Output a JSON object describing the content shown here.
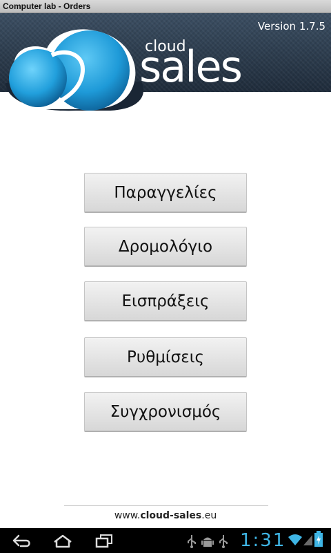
{
  "window": {
    "title": "Computer lab - Orders"
  },
  "header": {
    "version": "Version 1.7.5",
    "logo_cloud": "cloud",
    "logo_sales": "sales",
    "colors": {
      "logo_blue": "#29a6e3",
      "logo_dark": "#0a5f96"
    }
  },
  "menu": {
    "items": [
      {
        "label": "Παραγγελίες"
      },
      {
        "label": "Δρομολόγιο"
      },
      {
        "label": "Εισπράξεις"
      },
      {
        "label": "Ρυθμίσεις"
      },
      {
        "label": "Συγχρονισμός"
      }
    ]
  },
  "footer": {
    "url_prefix": "www.",
    "url_brand": "cloud-sales",
    "url_suffix": ".eu"
  },
  "system_bar": {
    "time": "1:31",
    "icons": [
      "back-icon",
      "home-icon",
      "recent-apps-icon",
      "usb-icon",
      "android-debug-icon",
      "usb-icon",
      "wifi-icon",
      "signal-icon",
      "battery-icon"
    ],
    "accent": "#3fb6e6"
  }
}
